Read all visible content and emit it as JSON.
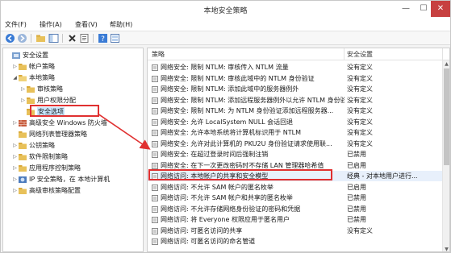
{
  "window": {
    "title": "本地安全策略",
    "min": "—",
    "max": "☐",
    "close": "✕"
  },
  "menu": [
    "文件(F)",
    "操作(A)",
    "查看(V)",
    "帮助(H)"
  ],
  "toolbar": [
    "back-icon",
    "forward-icon",
    "up-folder-icon",
    "show-tree-icon",
    "delete-icon",
    "properties-icon",
    "help-icon",
    "view-icon"
  ],
  "tree": [
    {
      "label": "安全设置",
      "arrow": "",
      "depth": 0
    },
    {
      "label": "帐户策略",
      "arrow": "▷",
      "depth": 1
    },
    {
      "label": "本地策略",
      "arrow": "◢",
      "depth": 1
    },
    {
      "label": "审核策略",
      "arrow": "▷",
      "depth": 2
    },
    {
      "label": "用户权限分配",
      "arrow": "▷",
      "depth": 2
    },
    {
      "label": "安全选项",
      "arrow": "",
      "depth": 2,
      "selected": true
    },
    {
      "label": "高级安全 Windows 防火墙",
      "arrow": "▷",
      "depth": 1
    },
    {
      "label": "网络列表管理器策略",
      "arrow": "",
      "depth": 1
    },
    {
      "label": "公钥策略",
      "arrow": "▷",
      "depth": 1
    },
    {
      "label": "软件限制策略",
      "arrow": "▷",
      "depth": 1
    },
    {
      "label": "应用程序控制策略",
      "arrow": "▷",
      "depth": 1
    },
    {
      "label": "IP 安全策略，在 本地计算机",
      "arrow": "▷",
      "depth": 1
    },
    {
      "label": "高级审核策略配置",
      "arrow": "▷",
      "depth": 1
    }
  ],
  "list": {
    "headers": {
      "policy": "策略",
      "setting": "安全设置"
    },
    "rows": [
      {
        "policy": "网络安全: 限制 NTLM: 审核传入 NTLM 流量",
        "setting": "没有定义"
      },
      {
        "policy": "网络安全: 限制 NTLM: 审核此域中的 NTLM 身份验证",
        "setting": "没有定义"
      },
      {
        "policy": "网络安全: 限制 NTLM: 添加此域中的服务器例外",
        "setting": "没有定义"
      },
      {
        "policy": "网络安全: 限制 NTLM: 添加远程服务器例外以允许 NTLM 身份验证",
        "setting": "没有定义"
      },
      {
        "policy": "网络安全: 限制 NTLM: 为 NTLM 身份验证添加远程服务器...",
        "setting": "没有定义"
      },
      {
        "policy": "网络安全: 允许 LocalSystem NULL 会话回退",
        "setting": "没有定义"
      },
      {
        "policy": "网络安全: 允许本地系统将计算机标识用于 NTLM",
        "setting": "没有定义"
      },
      {
        "policy": "网络安全: 允许对此计算机的 PKU2U 身份验证请求使用联...",
        "setting": "没有定义"
      },
      {
        "policy": "网络安全: 在超过登录时间后强制注销",
        "setting": "已禁用"
      },
      {
        "policy": "网络安全: 在下一次更改密码时不存储 LAN 管理器哈希值",
        "setting": "已启用"
      },
      {
        "policy": "网络访问: 本地帐户的共享和安全模型",
        "setting": "经典 - 对本地用户进行...",
        "highlight": true
      },
      {
        "policy": "网络访问: 不允许 SAM 帐户的匿名枚举",
        "setting": "已启用"
      },
      {
        "policy": "网络访问: 不允许 SAM 帐户和共享的匿名枚举",
        "setting": "已禁用"
      },
      {
        "policy": "网络访问: 不允许存储网络身份验证的密码和凭据",
        "setting": "已禁用"
      },
      {
        "policy": "网络访问: 将 Everyone 权限应用于匿名用户",
        "setting": "已禁用"
      },
      {
        "policy": "网络访问: 可匿名访问的共享",
        "setting": "没有定义"
      },
      {
        "policy": "网络访问: 可匿名访问的命名管道",
        "setting": ""
      }
    ]
  },
  "colors": {
    "annotation": "#e03030",
    "folder": "#e8c15a",
    "selection": "#cce8ff"
  }
}
